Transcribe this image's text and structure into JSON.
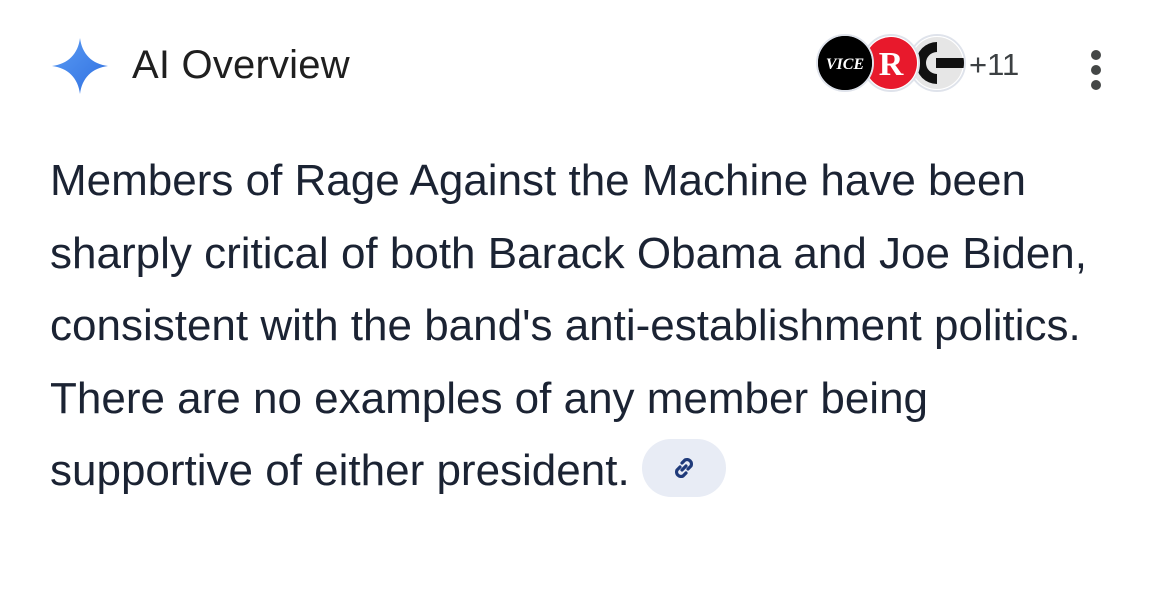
{
  "header": {
    "title": "AI Overview",
    "more_sources_label": "+11"
  },
  "sources": [
    {
      "name": "VICE",
      "icon": "vice-logo-icon"
    },
    {
      "name": "R",
      "icon": "r-logo-icon"
    },
    {
      "name": "C",
      "icon": "c-logo-icon"
    }
  ],
  "overview": {
    "text": "Members of Rage Against the Machine have been sharply critical of both Barack Obama and Joe Biden, consistent with the band's anti-establishment politics. There are no examples of any member being supportive of either president."
  },
  "icons": {
    "sparkle": "gemini-sparkle-icon",
    "menu": "more-vert-icon",
    "link": "link-icon"
  },
  "colors": {
    "sparkle_blue": "#4a86e8",
    "text": "#1b2333",
    "chip_bg": "#e8ecf5",
    "r_red": "#e8192c"
  }
}
